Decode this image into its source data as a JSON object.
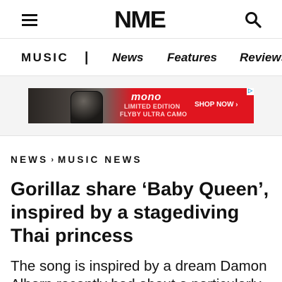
{
  "header": {
    "logo_text": "NME",
    "menu_icon": "hamburger-menu-icon",
    "search_icon": "search-icon"
  },
  "nav": {
    "section": "MUSIC",
    "separator": "|",
    "links": [
      "News",
      "Features",
      "Reviews"
    ]
  },
  "ad": {
    "brand": "mono",
    "line1": "LIMITED EDITION",
    "line2": "FLYBY ULTRA CAMO",
    "cta": "SHOP NOW ›",
    "accent_color": "#e0151f"
  },
  "breadcrumb": {
    "items": [
      "NEWS",
      "MUSIC NEWS"
    ],
    "separator": "›"
  },
  "article": {
    "headline_line1": "Gorillaz share ‘Baby Queen’,",
    "headline_line2": "inspired by a stagediving",
    "headline_line3": "Thai princess",
    "standfirst_line1": "The song is inspired by a dream Damon",
    "standfirst_line2": "Albarn recently had about a particularly"
  }
}
